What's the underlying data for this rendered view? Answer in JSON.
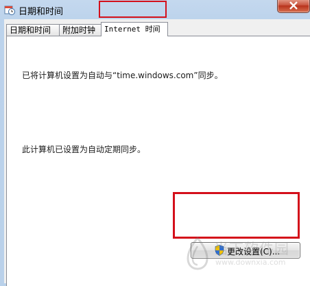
{
  "window": {
    "title": "日期和时间",
    "title_icon": "clock-calendar-icon",
    "close_icon": "close-icon"
  },
  "tabs": [
    {
      "label": "日期和时间",
      "selected": false
    },
    {
      "label": "附加时钟",
      "selected": false
    },
    {
      "label": "Internet 时间",
      "selected": true
    }
  ],
  "panel": {
    "sync_message": "已将计算机设置为自动与“time.windows.com”同步。",
    "auto_message": "此计算机已设置为自动定期同步。",
    "change_button_label": "更改设置(C)...",
    "change_button_icon": "uac-shield-icon"
  },
  "watermark": {
    "brand": "当下软件园",
    "url": "www.downxia.com"
  },
  "colors": {
    "highlight_red": "#d40f1a",
    "titlebar": "#bcd3ec",
    "close_button": "#c7503a"
  }
}
